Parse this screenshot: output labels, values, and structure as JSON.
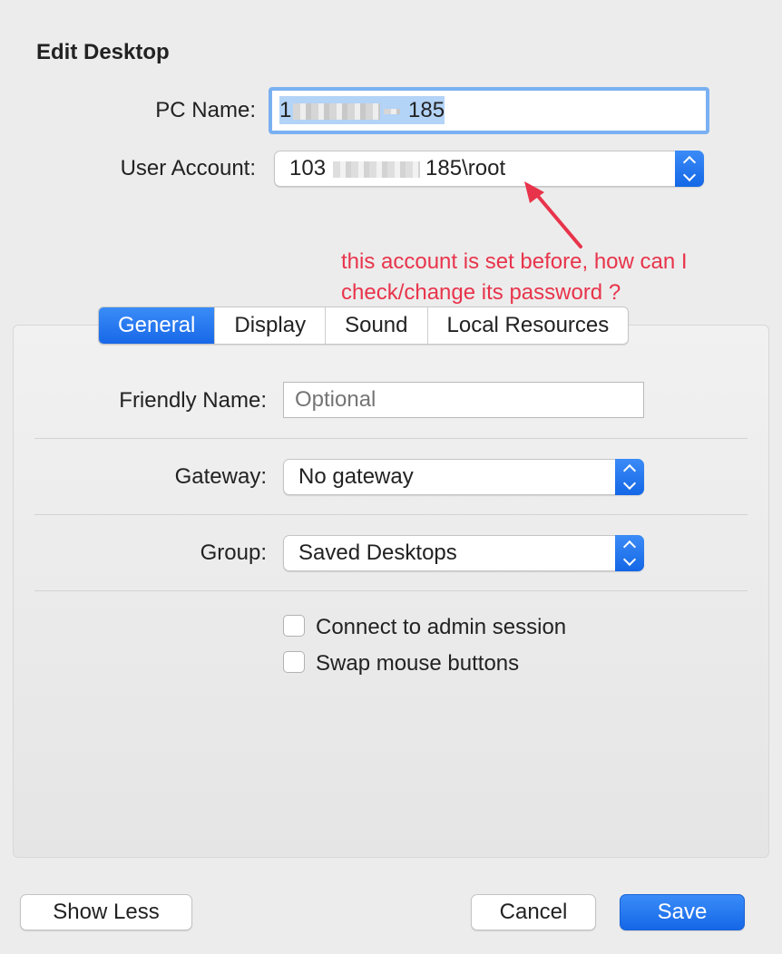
{
  "dialog": {
    "title": "Edit Desktop"
  },
  "pc_name": {
    "label": "PC Name:",
    "value_prefix": "1",
    "value_suffix": "185"
  },
  "user_account": {
    "label": "User Account:",
    "value_prefix": "103",
    "value_suffix": "185\\root"
  },
  "annotation": {
    "line1": "this account is set before, how can I",
    "line2": "check/change its password ?",
    "color": "#e8344b"
  },
  "tabs": [
    {
      "label": "General",
      "active": true
    },
    {
      "label": "Display",
      "active": false
    },
    {
      "label": "Sound",
      "active": false
    },
    {
      "label": "Local Resources",
      "active": false
    }
  ],
  "general": {
    "friendly_name": {
      "label": "Friendly Name:",
      "placeholder": "Optional"
    },
    "gateway": {
      "label": "Gateway:",
      "value": "No gateway"
    },
    "group": {
      "label": "Group:",
      "value": "Saved Desktops"
    },
    "checkboxes": [
      {
        "label": "Connect to admin session",
        "checked": false
      },
      {
        "label": "Swap mouse buttons",
        "checked": false
      }
    ]
  },
  "buttons": {
    "show_less": "Show Less",
    "cancel": "Cancel",
    "save": "Save"
  },
  "colors": {
    "accent": "#1a6ef0",
    "background": "#ececec"
  }
}
